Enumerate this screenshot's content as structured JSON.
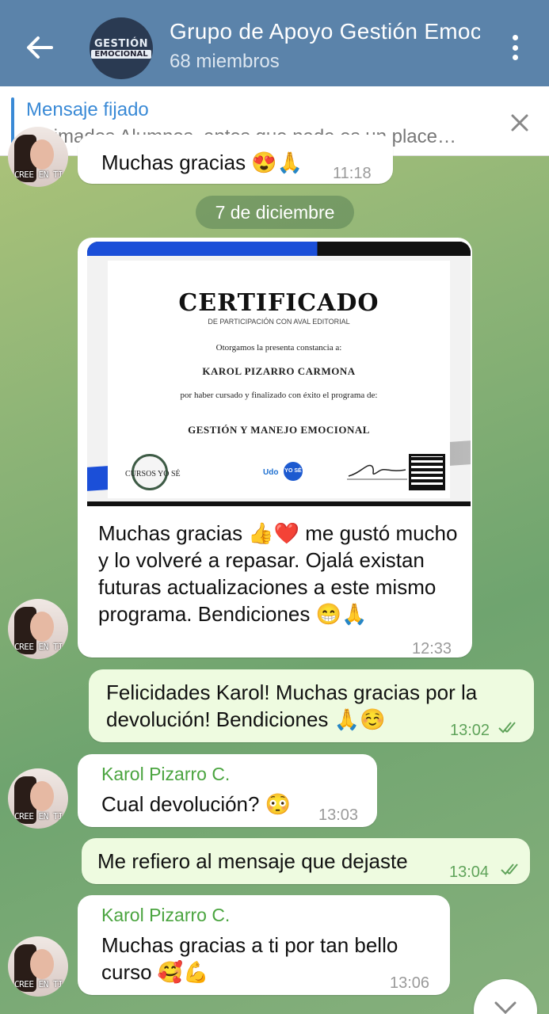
{
  "header": {
    "title": "Grupo de Apoyo Gestión Emocional",
    "members": "68 miembros",
    "avatar_line1": "GESTIÓN",
    "avatar_line2": "EMOCIONAL"
  },
  "pinned": {
    "label": "Mensaje fijado",
    "text": "Estimados Alumnos, antes que nada es un place…"
  },
  "messages": {
    "m0": {
      "text": "Muchas gracias 😍🙏",
      "time": "11:18"
    },
    "date": "7 de diciembre",
    "m1": {
      "text": "Muchas gracias 👍❤️ me gustó mucho y lo volveré a repasar. Ojalá existan futuras actualizaciones a este mismo programa. Bendiciones 😁🙏",
      "time": "12:33"
    },
    "m2": {
      "text": "Felicidades Karol! Muchas gracias por la devolución! Bendiciones 🙏☺️",
      "time": "13:02"
    },
    "m3": {
      "sender": "Karol Pizarro C.",
      "text": "Cual devolución? 😳",
      "time": "13:03"
    },
    "m4": {
      "text": "Me refiero al mensaje que dejaste",
      "time": "13:04"
    },
    "m5": {
      "sender": "Karol Pizarro C.",
      "text": "Muchas gracias a ti por tan bello curso 🥰💪",
      "time": "13:06"
    }
  },
  "avatar_tag": "CREE EN TI",
  "certificate": {
    "title": "CERTIFICADO",
    "subtitle": "DE PARTICIPACIÓN CON AVAL EDITORIAL",
    "line1": "Otorgamos la presenta constancia a:",
    "name": "KAROL PIZARRO CARMONA",
    "line2": "por haber cursado y finalizado con éxito el programa de:",
    "program": "GESTIÓN Y MANEJO EMOCIONAL",
    "seal": "CURSOS YO SÉ",
    "logo1": "Udo",
    "logo2": "YO SÉ"
  },
  "colors": {
    "header": "#5b83aa",
    "accent": "#3a8ad6",
    "sender": "#4aa43f",
    "outgoing": "#eefbe0"
  }
}
